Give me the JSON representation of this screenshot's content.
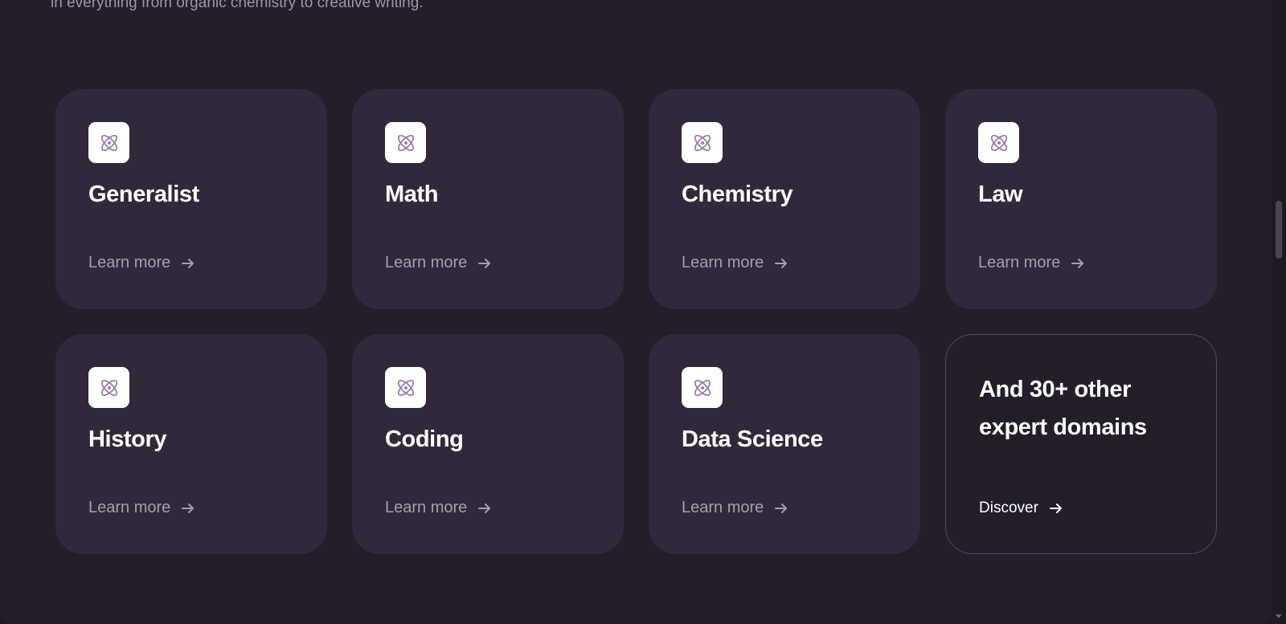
{
  "intro_text": "in everything from organic chemistry to creative writing.",
  "cards": [
    {
      "title": "Generalist",
      "link": "Learn more"
    },
    {
      "title": "Math",
      "link": "Learn more"
    },
    {
      "title": "Chemistry",
      "link": "Learn more"
    },
    {
      "title": "Law",
      "link": "Learn more"
    },
    {
      "title": "History",
      "link": "Learn more"
    },
    {
      "title": "Coding",
      "link": "Learn more"
    },
    {
      "title": "Data Science",
      "link": "Learn more"
    }
  ],
  "more_card": {
    "title": "And 30+ other expert domains",
    "link": "Discover"
  },
  "icons": {
    "card_icon": "atom-icon",
    "link_icon": "arrow-right-icon"
  },
  "colors": {
    "page_background": "#231e2a",
    "card_background": "#32283b",
    "badge_background": "#ffffff",
    "icon_stroke": "#9a7ea8"
  }
}
